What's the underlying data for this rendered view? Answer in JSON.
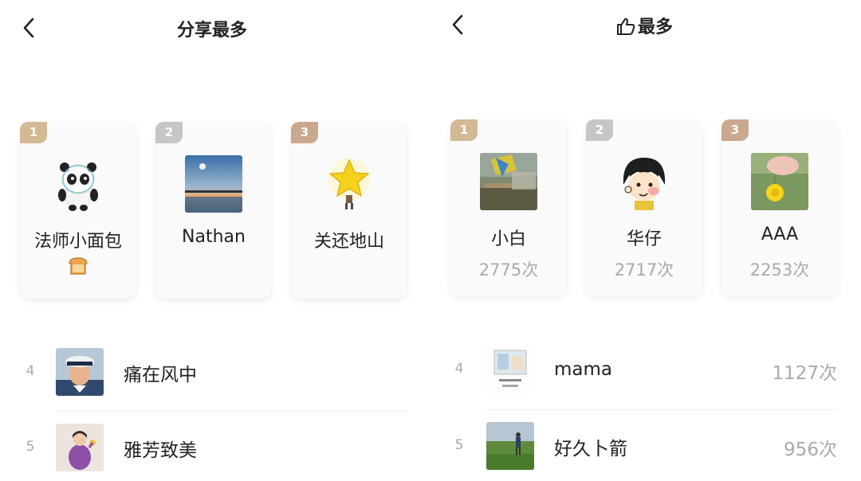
{
  "left": {
    "title": "分享最多",
    "top3": [
      {
        "rank": "1",
        "name": "法师小面包",
        "avatar": "panda-mascot-avatar"
      },
      {
        "rank": "2",
        "name": "Nathan",
        "avatar": "lake-sunset-avatar"
      },
      {
        "rank": "3",
        "name": "关还地山",
        "avatar": "star-character-avatar"
      }
    ],
    "list": [
      {
        "rank": "4",
        "name": "痛在风中",
        "avatar": "sailor-avatar"
      },
      {
        "rank": "5",
        "name": "雅芳致美",
        "avatar": "cartoon-lady-avatar"
      }
    ]
  },
  "right": {
    "title": "最多",
    "title_icon": "thumbs-up-icon",
    "top3": [
      {
        "rank": "1",
        "name": "小白",
        "count": "2775次",
        "avatar": "outdoor-photo-avatar"
      },
      {
        "rank": "2",
        "name": "华仔",
        "count": "2717次",
        "avatar": "cartoon-girl-avatar"
      },
      {
        "rank": "3",
        "name": "AAA",
        "count": "2253次",
        "avatar": "dandelion-hand-avatar"
      }
    ],
    "list": [
      {
        "rank": "4",
        "name": "mama",
        "count": "1127次",
        "avatar": "illustration-avatar"
      },
      {
        "rank": "5",
        "name": "好久卜箭",
        "count": "956次",
        "avatar": "field-walker-avatar"
      }
    ]
  },
  "colors": {
    "badge_gold": "#d4b995",
    "badge_silver": "#c6c6c6",
    "badge_bronze": "#c9a88d",
    "muted_text": "#aaaaaa"
  }
}
